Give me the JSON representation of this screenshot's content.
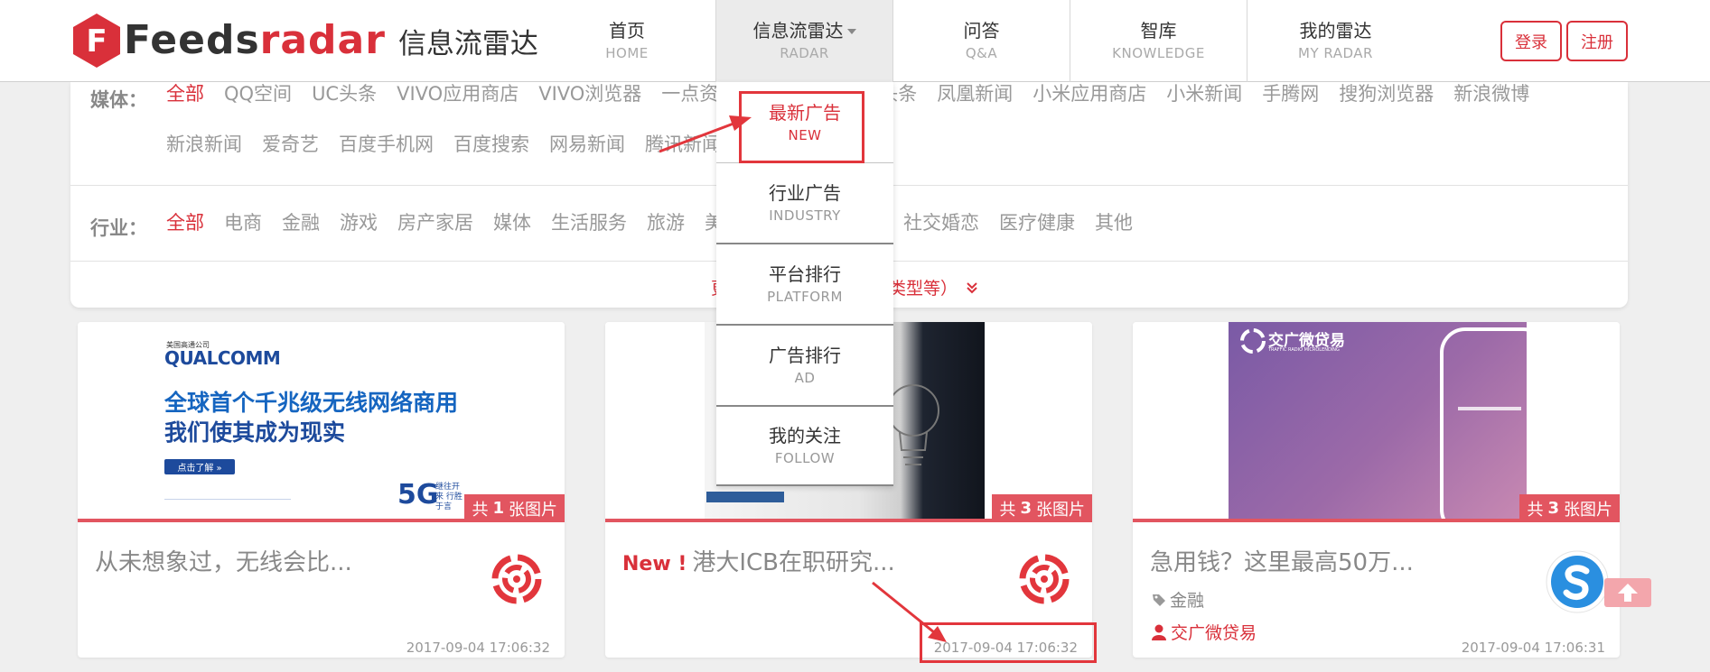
{
  "logo": {
    "word_dark": "Feeds",
    "word_red": "radar",
    "cn": "信息流雷达"
  },
  "nav": [
    {
      "cn": "首页",
      "en": "HOME"
    },
    {
      "cn": "信息流雷达",
      "en": "RADAR"
    },
    {
      "cn": "问答",
      "en": "Q&A"
    },
    {
      "cn": "智库",
      "en": "KNOWLEDGE"
    },
    {
      "cn": "我的雷达",
      "en": "MY RADAR"
    }
  ],
  "auth": {
    "login": "登录",
    "register": "注册"
  },
  "filter": {
    "media_label": "媒体：",
    "media_row1": [
      "全部",
      "QQ空间",
      "UC头条",
      "VIVO应用商店",
      "VIVO浏览器",
      "一点资",
      "",
      "",
      "头条",
      "凤凰新闻",
      "小米应用商店",
      "小米新闻",
      "手腾网",
      "搜狗浏览器",
      "新浪微博"
    ],
    "media_row2": [
      "新浪新闻",
      "爱奇艺",
      "百度手机网",
      "百度搜索",
      "网易新闻",
      "腾讯新闻"
    ],
    "industry_label": "行业：",
    "industry_a": [
      "全部",
      "电商",
      "金融",
      "游戏",
      "房产家居",
      "媒体",
      "生活服务",
      "旅游",
      "美"
    ],
    "industry_b": [
      "社交婚恋",
      "医疗健康",
      "其他"
    ],
    "more_left": "更",
    "more_right": "类型等）"
  },
  "dropdown": [
    {
      "cn": "最新广告",
      "en": "NEW"
    },
    {
      "cn": "行业广告",
      "en": "INDUSTRY"
    },
    {
      "cn": "平台排行",
      "en": "PLATFORM"
    },
    {
      "cn": "广告排行",
      "en": "AD"
    },
    {
      "cn": "我的关注",
      "en": "FOLLOW"
    }
  ],
  "cards": [
    {
      "badge_pre": "共",
      "badge_num": "1",
      "badge_post": "张图片",
      "title": "从未想象过，无线会比...",
      "time": "2017-09-04 17:06:32",
      "ad": {
        "brand_small": "美国高通公司",
        "brand": "QUALCOMM",
        "line1": "全球首个千兆级无线网络商用",
        "line2": "我们使其成为现实",
        "cta": "点击了解 »",
        "tag5g": "5G",
        "tag5g_sub": "继往开来 行胜于言"
      }
    },
    {
      "new_tag": "New !",
      "badge_pre": "共",
      "badge_num": "3",
      "badge_post": "张图片",
      "title": "港大ICB在职研究...",
      "time": "2017-09-04 17:06:32"
    },
    {
      "badge_pre": "共",
      "badge_num": "3",
      "badge_post": "张图片",
      "title": "急用钱？这里最高50万...",
      "category": "金融",
      "advertiser": "交广微贷易",
      "time": "2017-09-04 17:06:31",
      "ad": {
        "brand": "交广微贷易",
        "brand_en": "TRAFFIC RADIO MICROLENDING"
      }
    }
  ],
  "colors": {
    "accent": "#d9303a",
    "badge": "#e25560",
    "annotation": "#e2363c"
  }
}
